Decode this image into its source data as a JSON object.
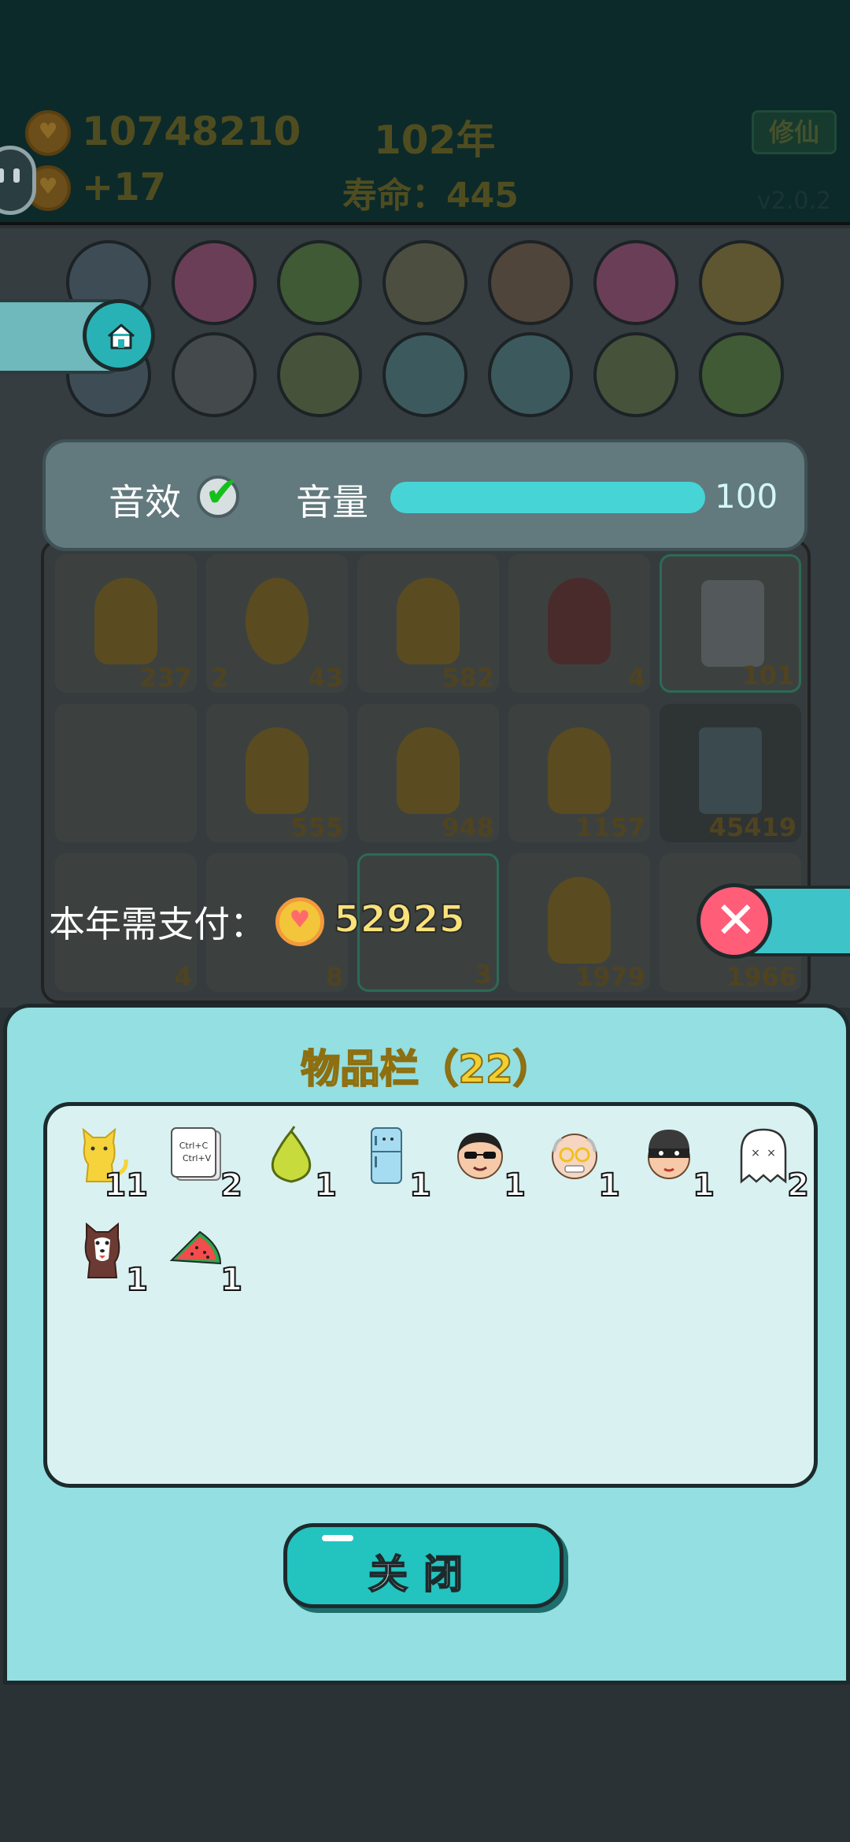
{
  "header": {
    "coins": "10748210",
    "coin_rate": "+17",
    "year": "102年",
    "lifespan": "寿命：445",
    "cultivate_label": "修仙",
    "version": "v2.0.2"
  },
  "board_numbers": [
    "237",
    "2",
    "43",
    "582",
    "4",
    "101",
    "555",
    "948",
    "1157",
    "45419",
    "4",
    "8",
    "3",
    "1979",
    "1966"
  ],
  "sound_panel": {
    "sfx_label": "音效",
    "sfx_enabled": true,
    "volume_label": "音量",
    "volume_value": "100",
    "volume_level": 1.0
  },
  "payment": {
    "label": "本年需支付：",
    "amount": "52925"
  },
  "inventory": {
    "title": "物品栏（22）",
    "items": [
      {
        "icon": "cat-icon",
        "count": "11"
      },
      {
        "icon": "ctrl-cv-card-icon",
        "count": "2",
        "text": "Ctrl+C Ctrl+V"
      },
      {
        "icon": "pomelo-icon",
        "count": "1"
      },
      {
        "icon": "fridge-icon",
        "count": "1"
      },
      {
        "icon": "sunglasses-man-icon",
        "count": "1"
      },
      {
        "icon": "old-man-glasses-icon",
        "count": "1"
      },
      {
        "icon": "thief-icon",
        "count": "1"
      },
      {
        "icon": "ghost-icon",
        "count": "2"
      },
      {
        "icon": "husky-dog-icon",
        "count": "1"
      },
      {
        "icon": "watermelon-icon",
        "count": "1"
      }
    ],
    "close_label": "关闭"
  },
  "colors": {
    "modal_bg": "#93dfe2",
    "accent_teal": "#23c3c0",
    "title_yellow": "#f2cf30",
    "close_red": "#ff5d78"
  }
}
